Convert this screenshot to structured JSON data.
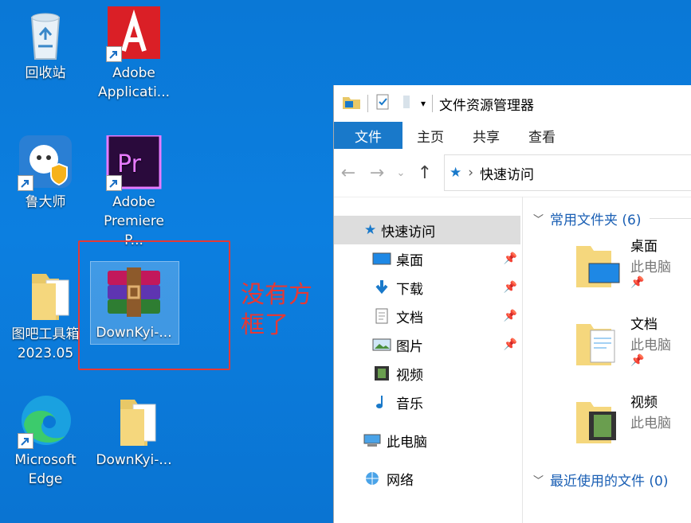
{
  "desktop": {
    "icons": [
      {
        "label": "回收站"
      },
      {
        "label": "Adobe Applicati..."
      },
      {
        "label": "鲁大师"
      },
      {
        "label": "Adobe Premiere P..."
      },
      {
        "label": "图吧工具箱 2023.05"
      },
      {
        "label": "DownKyi-..."
      },
      {
        "label": "Microsoft Edge"
      },
      {
        "label": "DownKyi-..."
      }
    ],
    "annotation": "没有方框了",
    "annotation_color": "#e53935"
  },
  "explorer": {
    "title": "文件资源管理器",
    "ribbon_tabs": [
      "文件",
      "主页",
      "共享",
      "查看"
    ],
    "address": "快速访问",
    "nav": {
      "quick_access": "快速访问",
      "items": [
        {
          "label": "桌面",
          "icon": "desktop-icon",
          "pinned": true
        },
        {
          "label": "下载",
          "icon": "download-icon",
          "pinned": true
        },
        {
          "label": "文档",
          "icon": "document-icon",
          "pinned": true
        },
        {
          "label": "图片",
          "icon": "picture-icon",
          "pinned": true
        },
        {
          "label": "视频",
          "icon": "video-icon",
          "pinned": false
        },
        {
          "label": "音乐",
          "icon": "music-icon",
          "pinned": false
        }
      ],
      "this_pc": "此电脑",
      "network": "网络"
    },
    "content": {
      "frequent_header": "常用文件夹 (6)",
      "folders": [
        {
          "name": "桌面",
          "location": "此电脑"
        },
        {
          "name": "文档",
          "location": "此电脑"
        },
        {
          "name": "视频",
          "location": "此电脑"
        }
      ],
      "recent_header": "最近使用的文件 (0)"
    },
    "accent": "#1979ca"
  }
}
